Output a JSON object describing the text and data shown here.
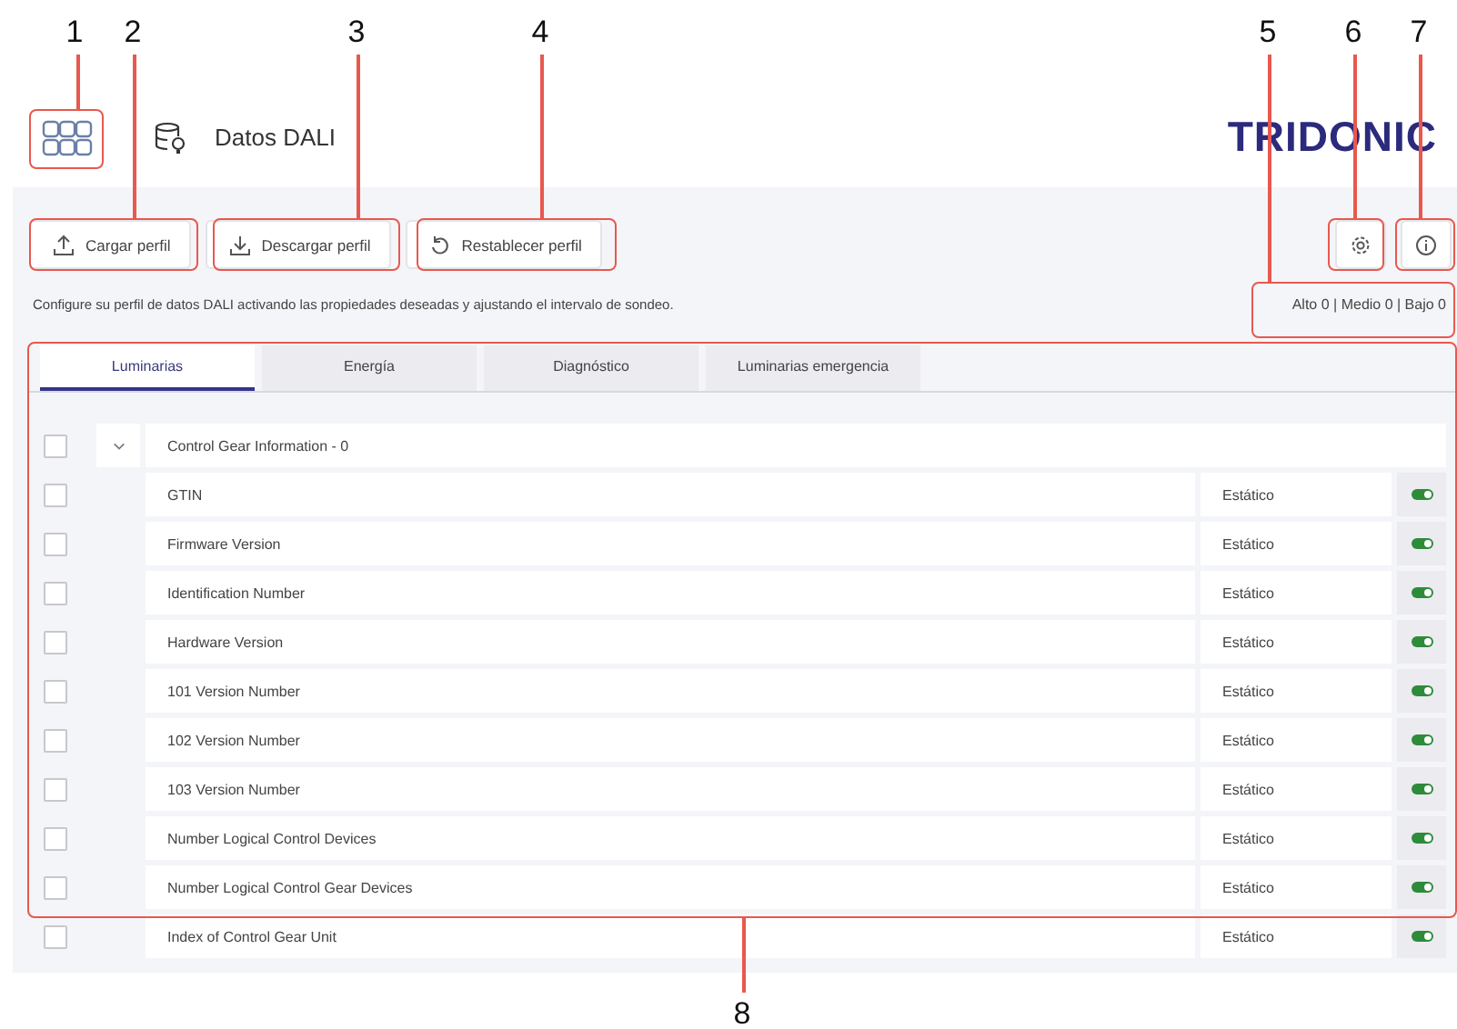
{
  "header": {
    "title": "Datos DALI",
    "logo": "TRIDONIC"
  },
  "toolbar": {
    "buttons": [
      {
        "label": "Cargar perfil",
        "kind": "upload"
      },
      {
        "label": "Descargar perfil",
        "kind": "download"
      },
      {
        "label": "Restablecer perfil",
        "kind": "reset"
      }
    ]
  },
  "description": "Configure su perfil de datos DALI activando las propiedades deseadas y ajustando el intervalo de sondeo.",
  "summary": "Alto 0 | Medio 0 | Bajo 0",
  "tabs": [
    {
      "label": "Luminarias",
      "selected": true
    },
    {
      "label": "Energía",
      "selected": false
    },
    {
      "label": "Diagnóstico",
      "selected": false
    },
    {
      "label": "Luminarias emergencia",
      "selected": false
    }
  ],
  "group": {
    "title": "Control Gear Information - 0",
    "checked": false,
    "expanded": true
  },
  "rows": [
    {
      "name": "GTIN",
      "type": "Estático",
      "checked": false,
      "on": true
    },
    {
      "name": "Firmware Version",
      "type": "Estático",
      "checked": false,
      "on": true
    },
    {
      "name": "Identification Number",
      "type": "Estático",
      "checked": false,
      "on": true
    },
    {
      "name": "Hardware Version",
      "type": "Estático",
      "checked": false,
      "on": true
    },
    {
      "name": "101 Version Number",
      "type": "Estático",
      "checked": false,
      "on": true
    },
    {
      "name": "102 Version Number",
      "type": "Estático",
      "checked": false,
      "on": true
    },
    {
      "name": "103 Version Number",
      "type": "Estático",
      "checked": false,
      "on": true
    },
    {
      "name": "Number Logical Control Devices",
      "type": "Estático",
      "checked": false,
      "on": true
    },
    {
      "name": "Number Logical Control Gear Devices",
      "type": "Estático",
      "checked": false,
      "on": true
    },
    {
      "name": "Index of Control Gear Unit",
      "type": "Estático",
      "checked": false,
      "on": true
    }
  ],
  "callouts": [
    "1",
    "2",
    "3",
    "4",
    "5",
    "6",
    "7",
    "8"
  ]
}
